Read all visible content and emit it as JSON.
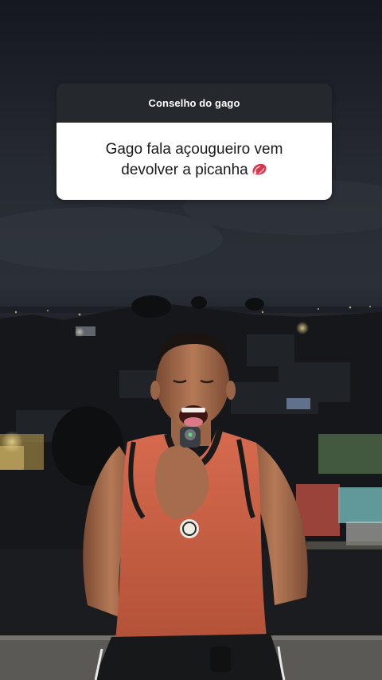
{
  "question_box": {
    "title": "Conselho do gago",
    "answer": "Gago fala açougueiro vem devolver a picanha",
    "emoji": "meat-icon"
  }
}
